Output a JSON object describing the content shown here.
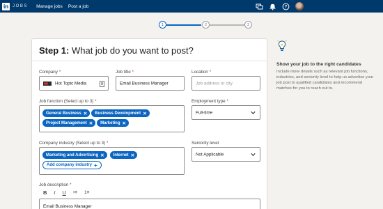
{
  "topbar": {
    "logo_mark": "in",
    "logo_text": "JOBS",
    "nav": [
      "Manage jobs",
      "Post a job"
    ],
    "icons": [
      "messages-icon",
      "notifications-icon",
      "help-icon",
      "profile-avatar"
    ]
  },
  "stepper": {
    "steps": [
      "1",
      "2",
      "3"
    ],
    "current": 1
  },
  "form": {
    "heading_step": "Step 1:",
    "heading_text": "What job do you want to post?",
    "company": {
      "label": "Company",
      "value": "Hot Topic Media"
    },
    "job_title": {
      "label": "Job title",
      "value": "Email Business Manager"
    },
    "location": {
      "label": "Location",
      "placeholder": "Job address or city"
    },
    "job_function": {
      "label": "Job function (Select up to 3)",
      "tags": [
        "General Business",
        "Business Development",
        "Project Management",
        "Marketing"
      ]
    },
    "employment_type": {
      "label": "Employment type",
      "value": "Full-time"
    },
    "company_industry": {
      "label": "Company industry (Select up to 3)",
      "tags": [
        "Marketing and Advertising",
        "Internet"
      ],
      "add_label": "Add company industry"
    },
    "seniority": {
      "label": "Seniority level",
      "value": "Not Applicable"
    },
    "description": {
      "label": "Job description",
      "toolbar": [
        "B",
        "I",
        "U",
        "•≡",
        "1≡"
      ],
      "value": "Email Business Manager"
    }
  },
  "tips": {
    "title": "Show your job to the right candidates",
    "body": "Include more details such as relevant job functions, industries, and seniority level to help us advertise your job post to qualified candidates and recommend matches for you to reach out to."
  },
  "colors": {
    "nav_bg": "#00396b",
    "accent": "#0a66c2",
    "required": "#c0392b"
  }
}
